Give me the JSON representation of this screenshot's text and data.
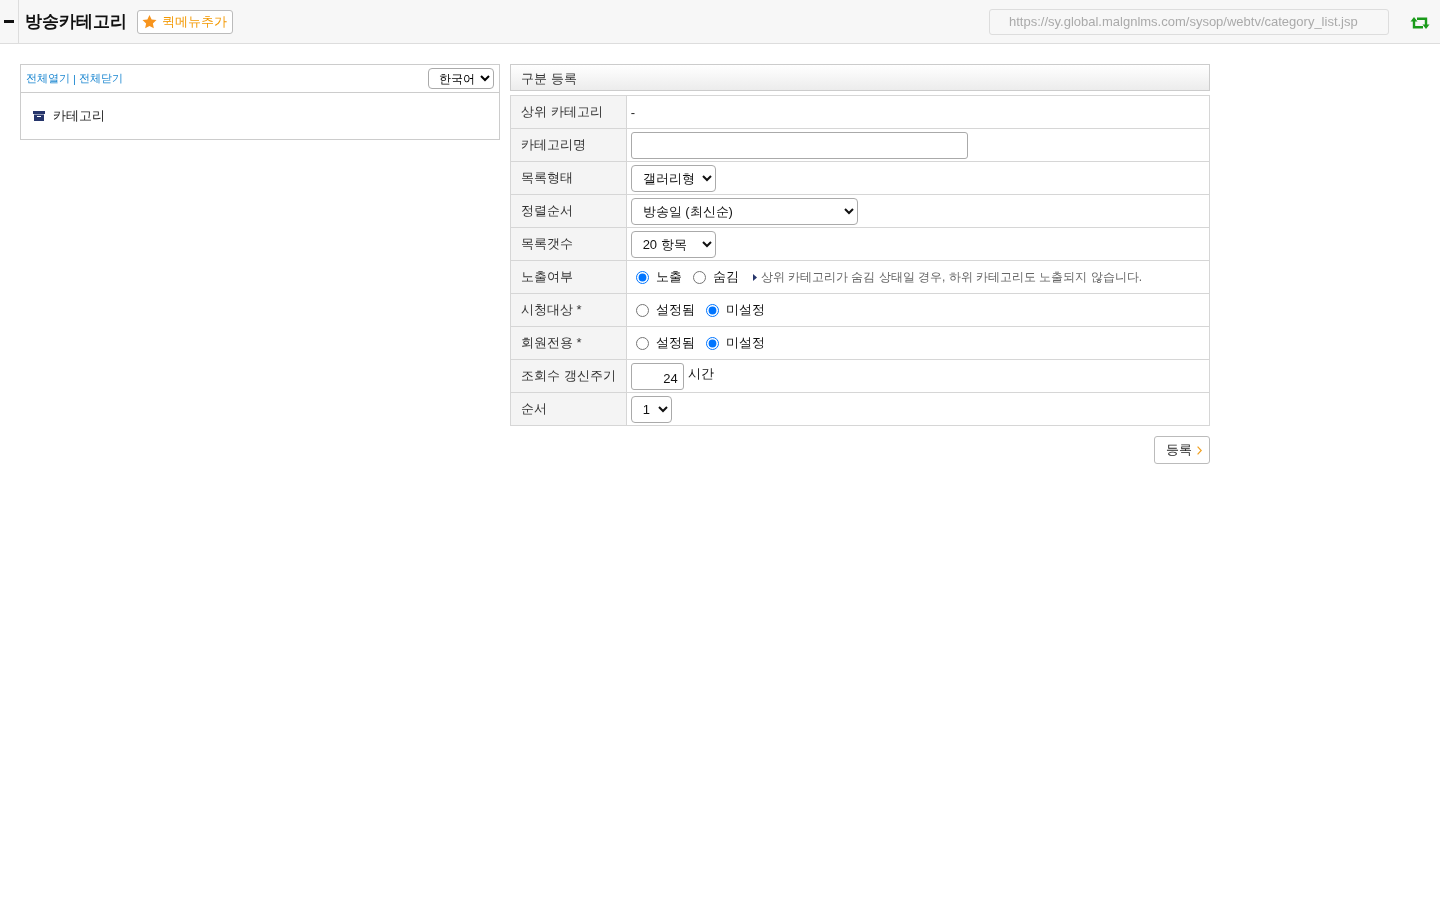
{
  "header": {
    "title": "방송카테고리",
    "quick_menu_button": "퀵메뉴추가",
    "url": "https://sy.global.malgnlms.com/sysop/webtv/category_list.jsp"
  },
  "category_panel": {
    "links": [
      {
        "label": "전체열기"
      },
      {
        "label": "전체닫기"
      }
    ],
    "separator": "|",
    "language": "한국어",
    "tree": [
      {
        "label": "카테고리"
      }
    ]
  },
  "form": {
    "title": "구분 등록",
    "rows": [
      {
        "label": "상위 카테고리",
        "kind": "text",
        "value": "-"
      },
      {
        "label": "카테고리명",
        "kind": "input"
      },
      {
        "label": "목록형태",
        "kind": "select",
        "value": "갤러리형"
      },
      {
        "label": "정렬순서",
        "kind": "select",
        "value": "방송일 (최신순)"
      },
      {
        "label": "목록갯수",
        "kind": "select",
        "value": "20 항목"
      },
      {
        "label": "노출여부",
        "kind": "radio",
        "options": [
          {
            "label": "노출",
            "selected": true
          },
          {
            "label": "숨김",
            "selected": false
          }
        ],
        "note": "상위 카테고리가 숨김 상태일 경우, 하위 카테고리도 노출되지 않습니다."
      },
      {
        "label": "시청대상 *",
        "kind": "radio",
        "options": [
          {
            "label": "설정됨",
            "selected": false
          },
          {
            "label": "미설정",
            "selected": true
          }
        ]
      },
      {
        "label": "회원전용 *",
        "kind": "radio",
        "options": [
          {
            "label": "설정됨",
            "selected": false
          },
          {
            "label": "미설정",
            "selected": true
          }
        ]
      },
      {
        "label": "조회수 갱신주기",
        "kind": "number",
        "value": "24",
        "unit": "시간"
      },
      {
        "label": "순서",
        "kind": "select",
        "value": "1"
      }
    ],
    "submit_button": "등록"
  }
}
